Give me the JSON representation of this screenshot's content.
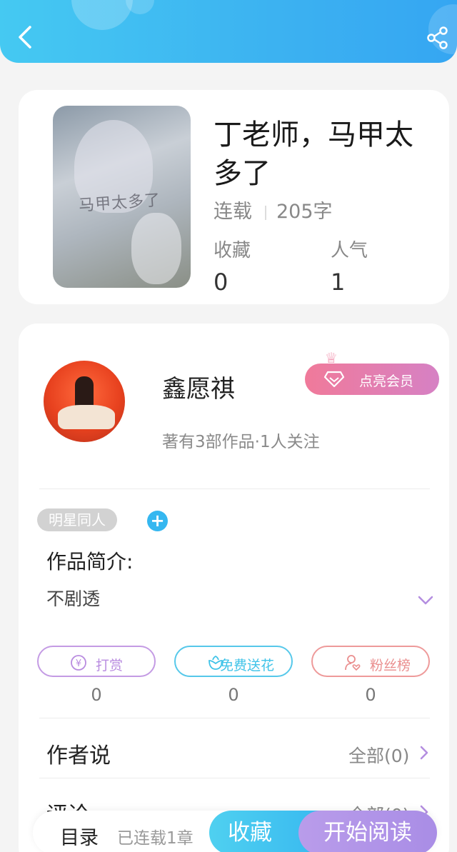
{
  "book": {
    "title": "丁老师，马甲太多了",
    "status": "连载",
    "word_count": "205字",
    "cover_text": "马甲太多了",
    "stats": [
      {
        "label": "收藏",
        "value": "0"
      },
      {
        "label": "人气",
        "value": "1"
      }
    ]
  },
  "author": {
    "name": "鑫愿祺",
    "meta": "著有3部作品·1人关注",
    "vip_button": "点亮会员"
  },
  "tag": "明星同人",
  "intro": {
    "title": "作品简介:",
    "text": "不剧透"
  },
  "actions": [
    {
      "label": "打赏",
      "count": "0",
      "color": "#b98ce0",
      "icon": "yen-icon"
    },
    {
      "label": "免费送花",
      "count": "0",
      "color": "#3fc3e8",
      "icon": "flower-icon"
    },
    {
      "label": "粉丝榜",
      "count": "0",
      "color": "#ea8e8e",
      "icon": "user-heart-icon"
    }
  ],
  "sections": [
    {
      "title": "作者说",
      "right": "全部(0)"
    },
    {
      "title": "评论",
      "right": "全部(0)"
    }
  ],
  "bottom_bar": {
    "toc": "目录",
    "chapters": "已连载1章",
    "favorite": "收藏",
    "start_reading": "开始阅读"
  }
}
